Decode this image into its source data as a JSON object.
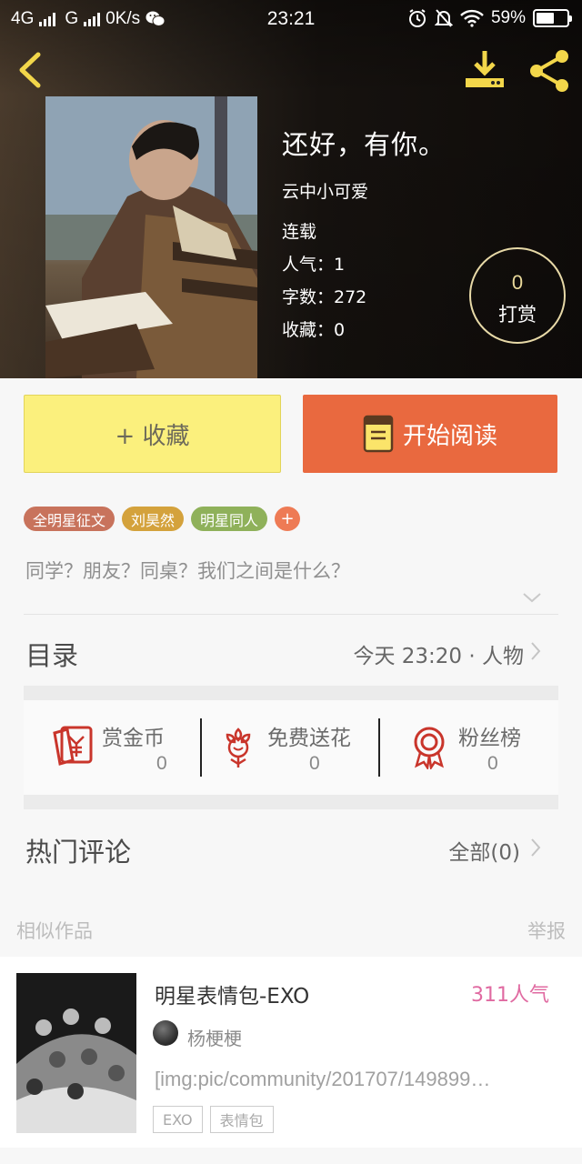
{
  "status_bar": {
    "network_1": "4G",
    "network_2": "G",
    "speed": "0K/s",
    "time": "23:21",
    "battery": "59%",
    "battery_level": 0.59
  },
  "book": {
    "title": "还好，有你。",
    "author": "云中小可爱",
    "status": "连载",
    "popularity": "人气：1",
    "word_count": "字数：272",
    "favorites": "收藏：0",
    "reward_count": "0",
    "reward_label": "打赏"
  },
  "actions": {
    "collect_label": "+ 收藏",
    "read_label": "开始阅读"
  },
  "tags": [
    {
      "label": "全明星征文",
      "color": "#c8735c"
    },
    {
      "label": "刘昊然",
      "color": "#d4a23c"
    },
    {
      "label": "明星同人",
      "color": "#8fb15a"
    }
  ],
  "tag_add": "+",
  "synopsis": "同学？朋友？同桌？我们之间是什么？",
  "catalog": {
    "label": "目录",
    "meta": "今天 23:20 · 人物"
  },
  "stats": [
    {
      "name": "赏金币",
      "value": "0",
      "icon": "red-envelope-icon"
    },
    {
      "name": "免费送花",
      "value": "0",
      "icon": "flower-icon"
    },
    {
      "name": "粉丝榜",
      "value": "0",
      "icon": "medal-icon"
    }
  ],
  "comments": {
    "label": "热门评论",
    "meta": "全部(0)"
  },
  "similar": {
    "heading": "相似作品",
    "report": "举报",
    "card": {
      "title": "明星表情包-EXO",
      "popularity": "311人气",
      "author": "杨梗梗",
      "excerpt": "[img:pic/community/201707/149899…",
      "tags": [
        "EXO",
        "表情包"
      ]
    }
  },
  "colors": {
    "accent_orange": "#e9693f",
    "collect_yellow": "#fbf07d",
    "icon_red": "#c9352b",
    "popularity_pink": "#e06aa1"
  }
}
